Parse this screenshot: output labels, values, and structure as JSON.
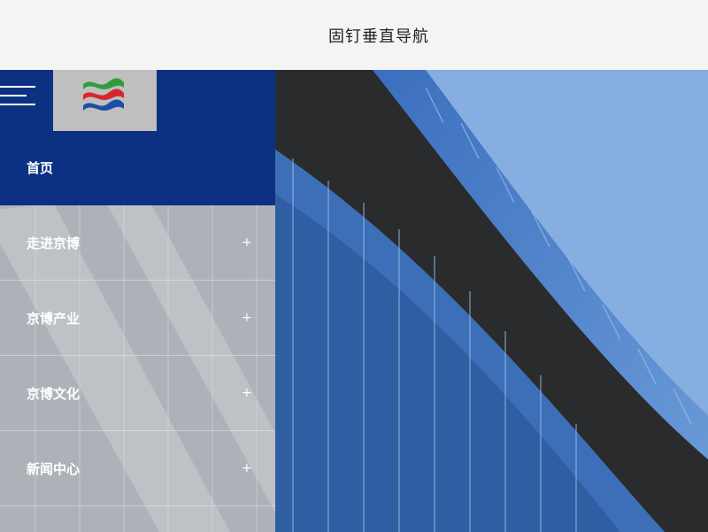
{
  "header": {
    "title": "固钉垂直导航"
  },
  "brand": {
    "logo_colors": [
      "#2e9e3d",
      "#d7262f",
      "#1d4ea8"
    ],
    "panel_color": "#0d3182"
  },
  "nav": {
    "items": [
      {
        "label": "首页",
        "expand": ""
      },
      {
        "label": "走进京博",
        "expand": "+"
      },
      {
        "label": "京博产业",
        "expand": "+"
      },
      {
        "label": "京博文化",
        "expand": "+"
      },
      {
        "label": "新闻中心",
        "expand": "+"
      }
    ]
  },
  "icons": {
    "menu": "hamburger-menu-icon",
    "logo": "company-logo-icon",
    "expand": "plus-icon"
  }
}
